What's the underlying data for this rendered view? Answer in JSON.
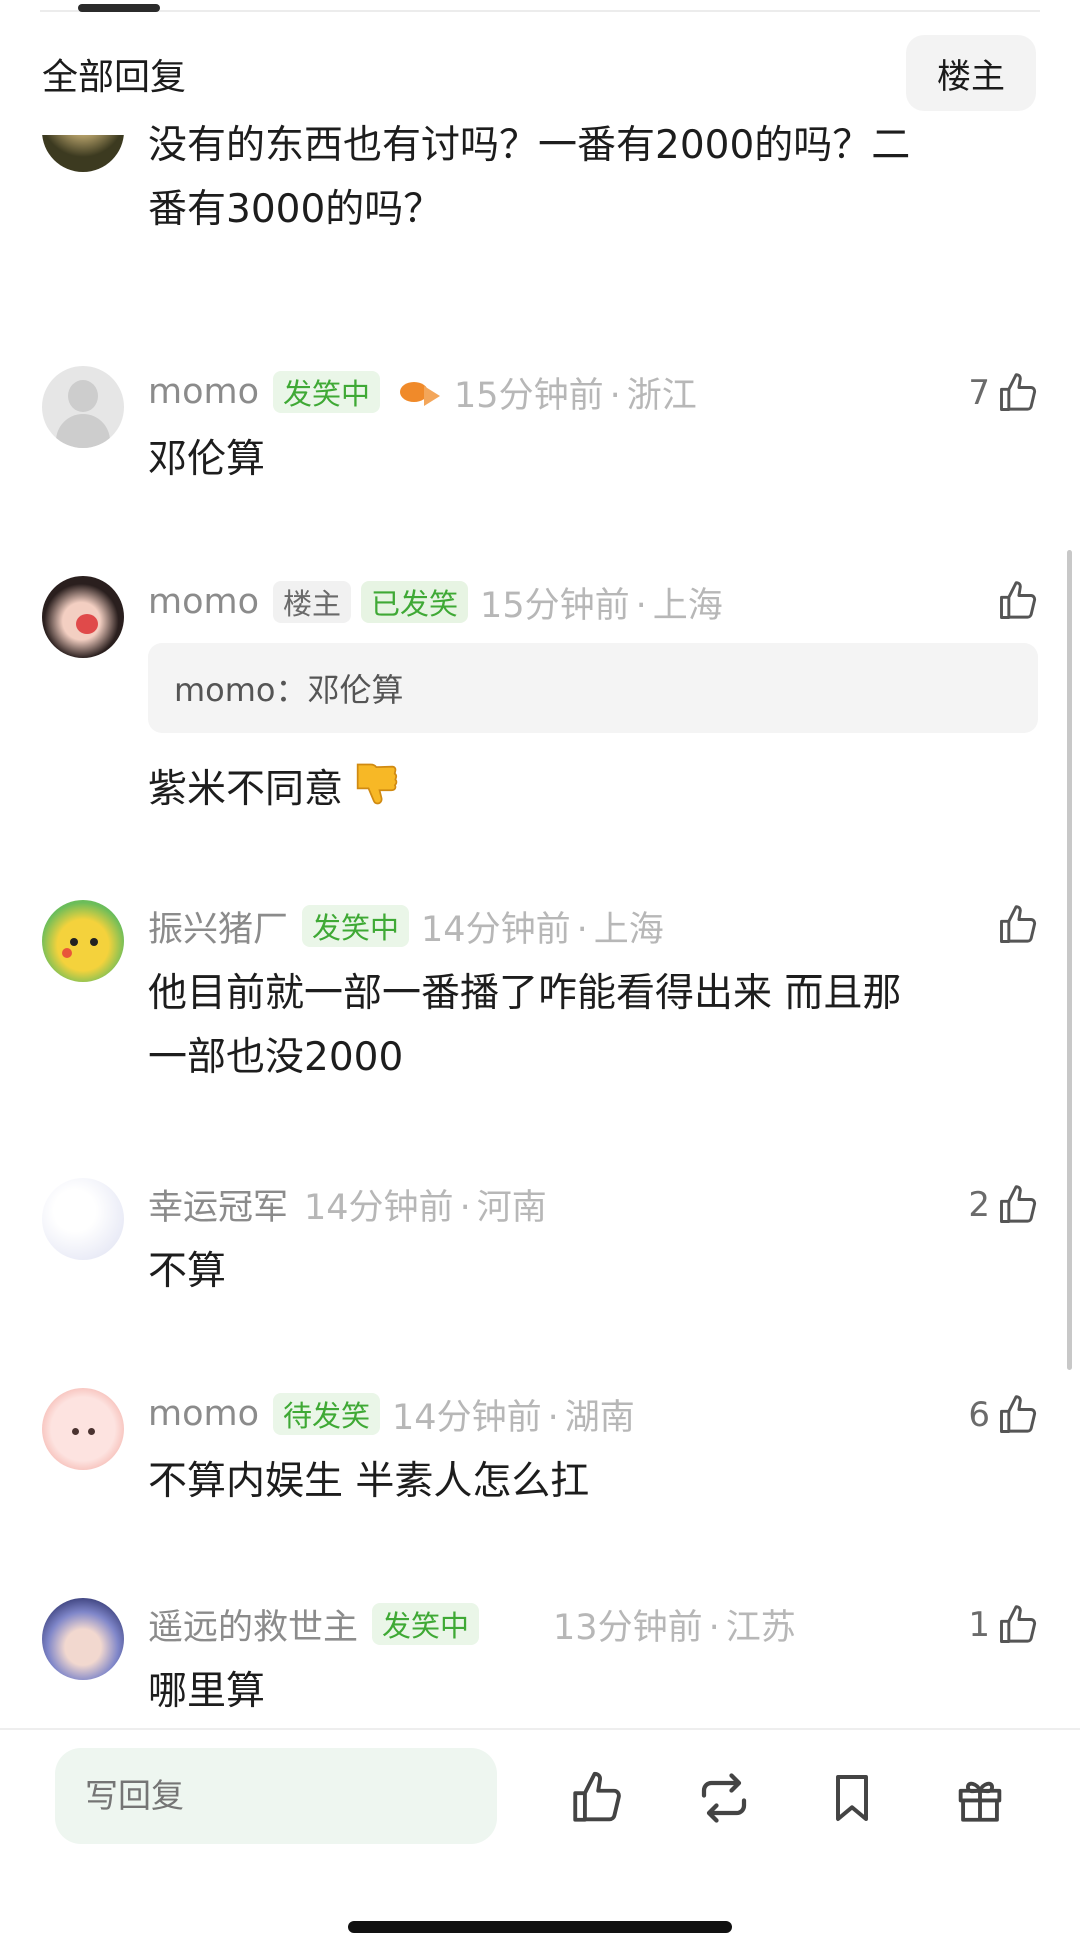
{
  "header": {
    "title": "全部回复",
    "owner_filter": "楼主"
  },
  "top_comment": {
    "text_line1": "没有的东西也有讨吗？一番有2000的吗？二",
    "text_line2": "番有3000的吗？"
  },
  "comments": [
    {
      "username": "momo",
      "badge": "发笑中",
      "time": "15分钟前",
      "location": "浙江",
      "likes": "7",
      "text": "邓伦算"
    },
    {
      "username": "momo",
      "owner_badge": "楼主",
      "badge": "已发笑",
      "time": "15分钟前",
      "location": "上海",
      "likes": "",
      "quote": "momo：邓伦算",
      "text": "紫米不同意"
    },
    {
      "username": "振兴猪厂",
      "badge": "发笑中",
      "time": "14分钟前",
      "location": "上海",
      "likes": "",
      "text_line1": "他目前就一部一番播了咋能看得出来 而且那",
      "text_line2": "一部也没2000"
    },
    {
      "username": "幸运冠军",
      "time": "14分钟前",
      "location": "河南",
      "likes": "2",
      "text": "不算"
    },
    {
      "username": "momo",
      "badge": "待发笑",
      "time": "14分钟前",
      "location": "湖南",
      "likes": "6",
      "text": "不算内娱生 半素人怎么扛"
    },
    {
      "username": "遥远的救世主",
      "badge": "发笑中",
      "time": "13分钟前",
      "location": "江苏",
      "likes": "1",
      "text": "哪里算"
    }
  ],
  "separator": "·",
  "bottom_bar": {
    "reply_placeholder": "写回复"
  },
  "colors": {
    "badge_green": "#3fa935",
    "badge_bg": "#eaf6e8",
    "meta_gray": "#b7b7b7"
  }
}
